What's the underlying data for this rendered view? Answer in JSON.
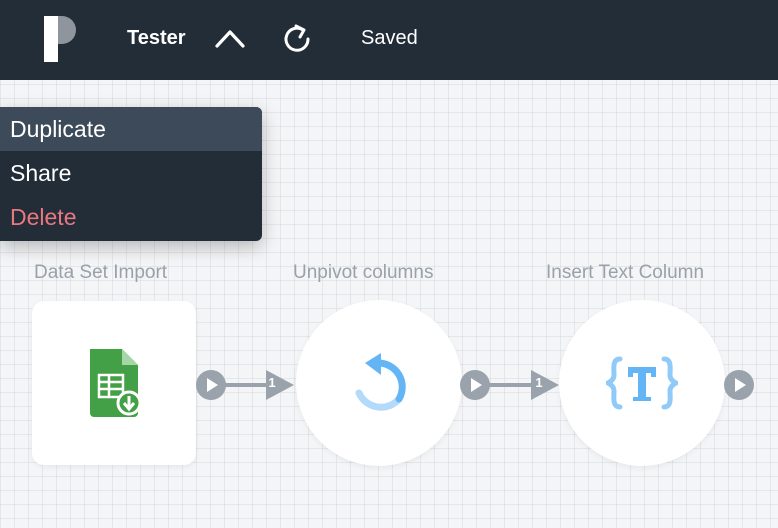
{
  "topbar": {
    "title": "Tester",
    "status": "Saved"
  },
  "menu": {
    "items": [
      {
        "label": "Duplicate"
      },
      {
        "label": "Share"
      },
      {
        "label": "Delete"
      }
    ]
  },
  "nodes": [
    {
      "label": "Data Set Import"
    },
    {
      "label": "Unpivot columns"
    },
    {
      "label": "Insert Text Column"
    }
  ],
  "edges": [
    {
      "count": "1"
    },
    {
      "count": "1"
    }
  ],
  "colors": {
    "topbar": "#222d38",
    "menu_active": "#3d4a59",
    "danger": "#e8777f",
    "port": "#9aa2ab",
    "accent_blue": "#64b5f6",
    "sheet_green": "#43a047"
  }
}
